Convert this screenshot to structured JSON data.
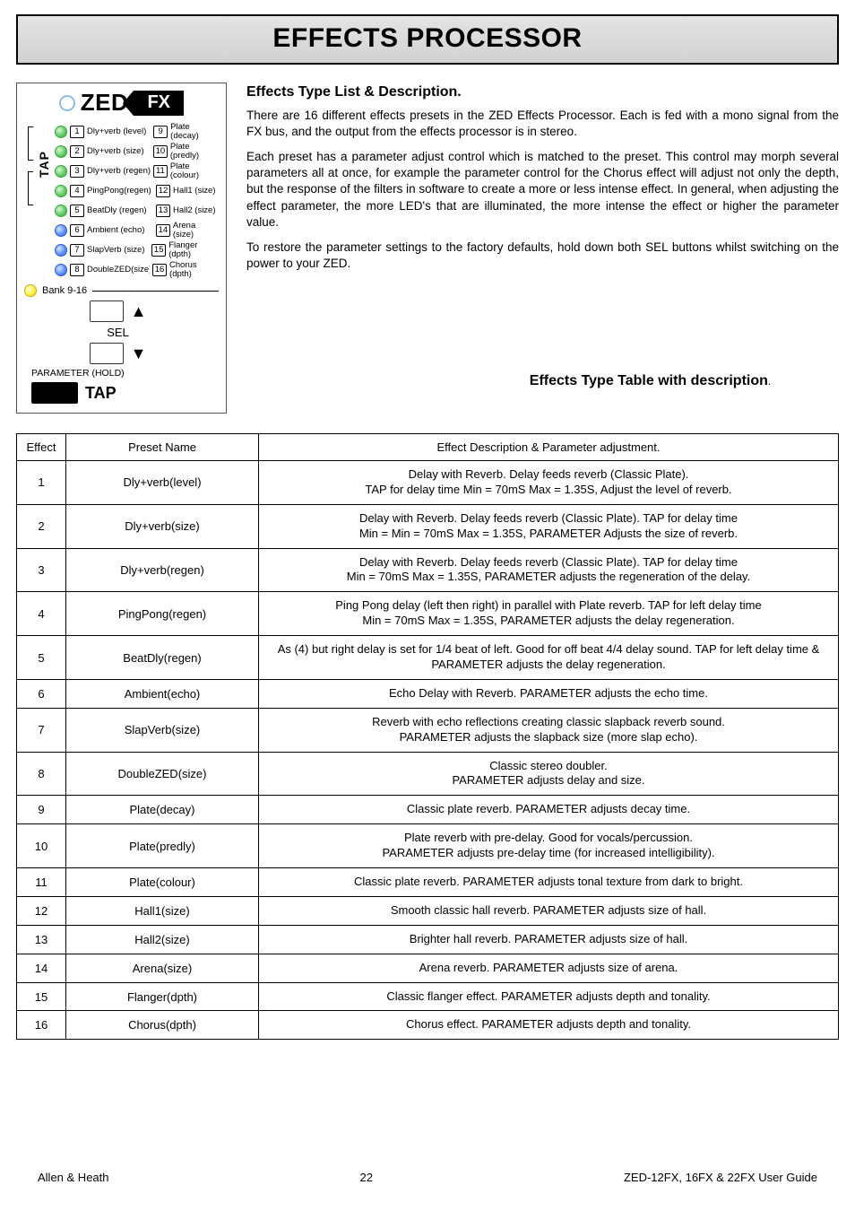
{
  "page_title": "EFFECTS PROCESSOR",
  "fxpanel": {
    "brand": "ZED",
    "logo": "FX",
    "tap_label": "TAP",
    "rows": [
      {
        "led": "grn",
        "n1": "1",
        "name1": "Dly+verb (level)",
        "n2": "9",
        "name2": "Plate (decay)"
      },
      {
        "led": "grn",
        "n1": "2",
        "name1": "Dly+verb (size)",
        "n2": "10",
        "name2": "Plate (predly)"
      },
      {
        "led": "grn",
        "n1": "3",
        "name1": "Dly+verb (regen)",
        "n2": "11",
        "name2": "Plate (colour)"
      },
      {
        "led": "grn",
        "n1": "4",
        "name1": "PingPong(regen)",
        "n2": "12",
        "name2": "Hall1 (size)"
      },
      {
        "led": "grn",
        "n1": "5",
        "name1": "BeatDly (regen)",
        "n2": "13",
        "name2": "Hall2 (size)"
      },
      {
        "led": "blu",
        "n1": "6",
        "name1": "Ambient (echo)",
        "n2": "14",
        "name2": "Arena (size)"
      },
      {
        "led": "blu",
        "n1": "7",
        "name1": "SlapVerb (size)",
        "n2": "15",
        "name2": "Flanger (dpth)"
      },
      {
        "led": "blu",
        "n1": "8",
        "name1": "DoubleZED(size)",
        "n2": "16",
        "name2": "Chorus (dpth)"
      }
    ],
    "bank": "Bank 9-16",
    "sel": "SEL",
    "param": "PARAMETER (HOLD)",
    "tap_big": "TAP"
  },
  "desc": {
    "heading": "Effects Type List & Description.",
    "p1": "There are 16 different effects presets in the ZED Effects Processor. Each is fed with a mono signal from the FX bus, and the output from the effects processor is in stereo.",
    "p2": "Each preset has a parameter adjust control which is matched to the preset. This control may morph several parameters all at once, for example the parameter control for the Chorus effect will adjust not only the depth, but the response of the filters in software to create a more or less intense effect. In general, when adjusting the effect parameter, the more LED's that are illuminated, the more intense the effect or higher the parameter value.",
    "p3": "To restore the parameter settings to the factory defaults, hold down both SEL buttons whilst switching on the power to your ZED."
  },
  "table_heading": "Effects Type Table with description",
  "columns": {
    "c1": "Effect",
    "c2": "Preset Name",
    "c3": "Effect Description & Parameter adjustment."
  },
  "table": [
    {
      "n": "1",
      "name": "Dly+verb(level)",
      "desc": "Delay with Reverb. Delay feeds reverb (Classic Plate).\nTAP for delay time  Min = 70mS Max = 1.35S, Adjust the level of reverb."
    },
    {
      "n": "2",
      "name": "Dly+verb(size)",
      "desc": "Delay with Reverb. Delay feeds reverb (Classic Plate). TAP for delay time\nMin = Min = 70mS Max = 1.35S, PARAMETER Adjusts the size of reverb."
    },
    {
      "n": "3",
      "name": "Dly+verb(regen)",
      "desc": "Delay with Reverb. Delay feeds reverb (Classic Plate). TAP for delay time\nMin = 70mS Max = 1.35S, PARAMETER adjusts the regeneration of the delay."
    },
    {
      "n": "4",
      "name": "PingPong(regen)",
      "desc": "Ping Pong delay (left then right) in parallel with Plate reverb. TAP for left delay time\nMin = 70mS Max = 1.35S, PARAMETER adjusts the delay regeneration."
    },
    {
      "n": "5",
      "name": "BeatDly(regen)",
      "desc": "As (4) but right delay is set for 1/4 beat of left. Good for off beat 4/4 delay sound. TAP for left delay time & PARAMETER adjusts the delay regeneration."
    },
    {
      "n": "6",
      "name": "Ambient(echo)",
      "desc": "Echo Delay with Reverb. PARAMETER adjusts the echo time."
    },
    {
      "n": "7",
      "name": "SlapVerb(size)",
      "desc": "Reverb with echo reflections creating classic slapback reverb sound.\nPARAMETER adjusts the slapback size (more slap echo)."
    },
    {
      "n": "8",
      "name": "DoubleZED(size)",
      "desc": "Classic stereo doubler.\nPARAMETER adjusts delay and size."
    },
    {
      "n": "9",
      "name": "Plate(decay)",
      "desc": "Classic plate reverb. PARAMETER adjusts decay time."
    },
    {
      "n": "10",
      "name": "Plate(predly)",
      "desc": "Plate reverb with pre-delay. Good for vocals/percussion.\nPARAMETER adjusts pre-delay time (for increased intelligibility)."
    },
    {
      "n": "11",
      "name": "Plate(colour)",
      "desc": "Classic plate reverb. PARAMETER adjusts tonal texture from dark to bright."
    },
    {
      "n": "12",
      "name": "Hall1(size)",
      "desc": "Smooth classic hall reverb. PARAMETER adjusts size of hall."
    },
    {
      "n": "13",
      "name": "Hall2(size)",
      "desc": "Brighter hall reverb. PARAMETER adjusts size of hall."
    },
    {
      "n": "14",
      "name": "Arena(size)",
      "desc": "Arena reverb. PARAMETER adjusts size of arena."
    },
    {
      "n": "15",
      "name": "Flanger(dpth)",
      "desc": "Classic flanger effect. PARAMETER adjusts depth and tonality."
    },
    {
      "n": "16",
      "name": "Chorus(dpth)",
      "desc": "Chorus effect. PARAMETER adjusts depth and tonality."
    }
  ],
  "footer": {
    "left": "Allen & Heath",
    "center": "22",
    "right": "ZED-12FX, 16FX & 22FX User Guide"
  }
}
